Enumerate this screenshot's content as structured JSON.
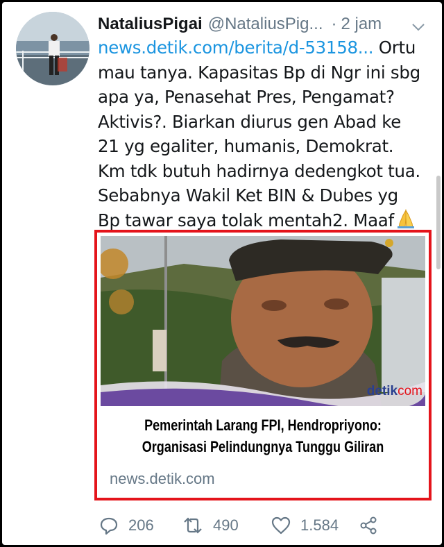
{
  "tweet": {
    "author_name": "NataliusPigai",
    "author_handle": "@NataliusPig...",
    "separator": "·",
    "time": "2 jam",
    "link": "news.detik.com/berita/d-53158...",
    "text_after_link": " Ortu mau tanya. Kapasitas Bp di Ngr ini sbg apa ya, Penasehat Pres, Pengamat? Aktivis?. Biarkan diurus gen Abad ke 21 yg egaliter, humanis, Demokrat. Km tdk butuh hadirnya dedengkot tua. Sebabnya Wakil Ket BIN & Dubes yg Bp tawar saya tolak mentah2. Maaf",
    "emoji_icon": "folded-hands-icon"
  },
  "card": {
    "brand_main": "detik",
    "brand_suffix": "com",
    "title_line1": "Pemerintah Larang FPI, Hendropriyono:",
    "title_line2": "Organisasi Pelindungnya Tunggu Giliran",
    "domain": "news.detik.com",
    "highlight_color": "#e4141b"
  },
  "actions": {
    "replies": "206",
    "retweets": "490",
    "likes": "1.584"
  },
  "colors": {
    "text": "#14171a",
    "muted": "#657786",
    "link": "#1b95e0"
  }
}
